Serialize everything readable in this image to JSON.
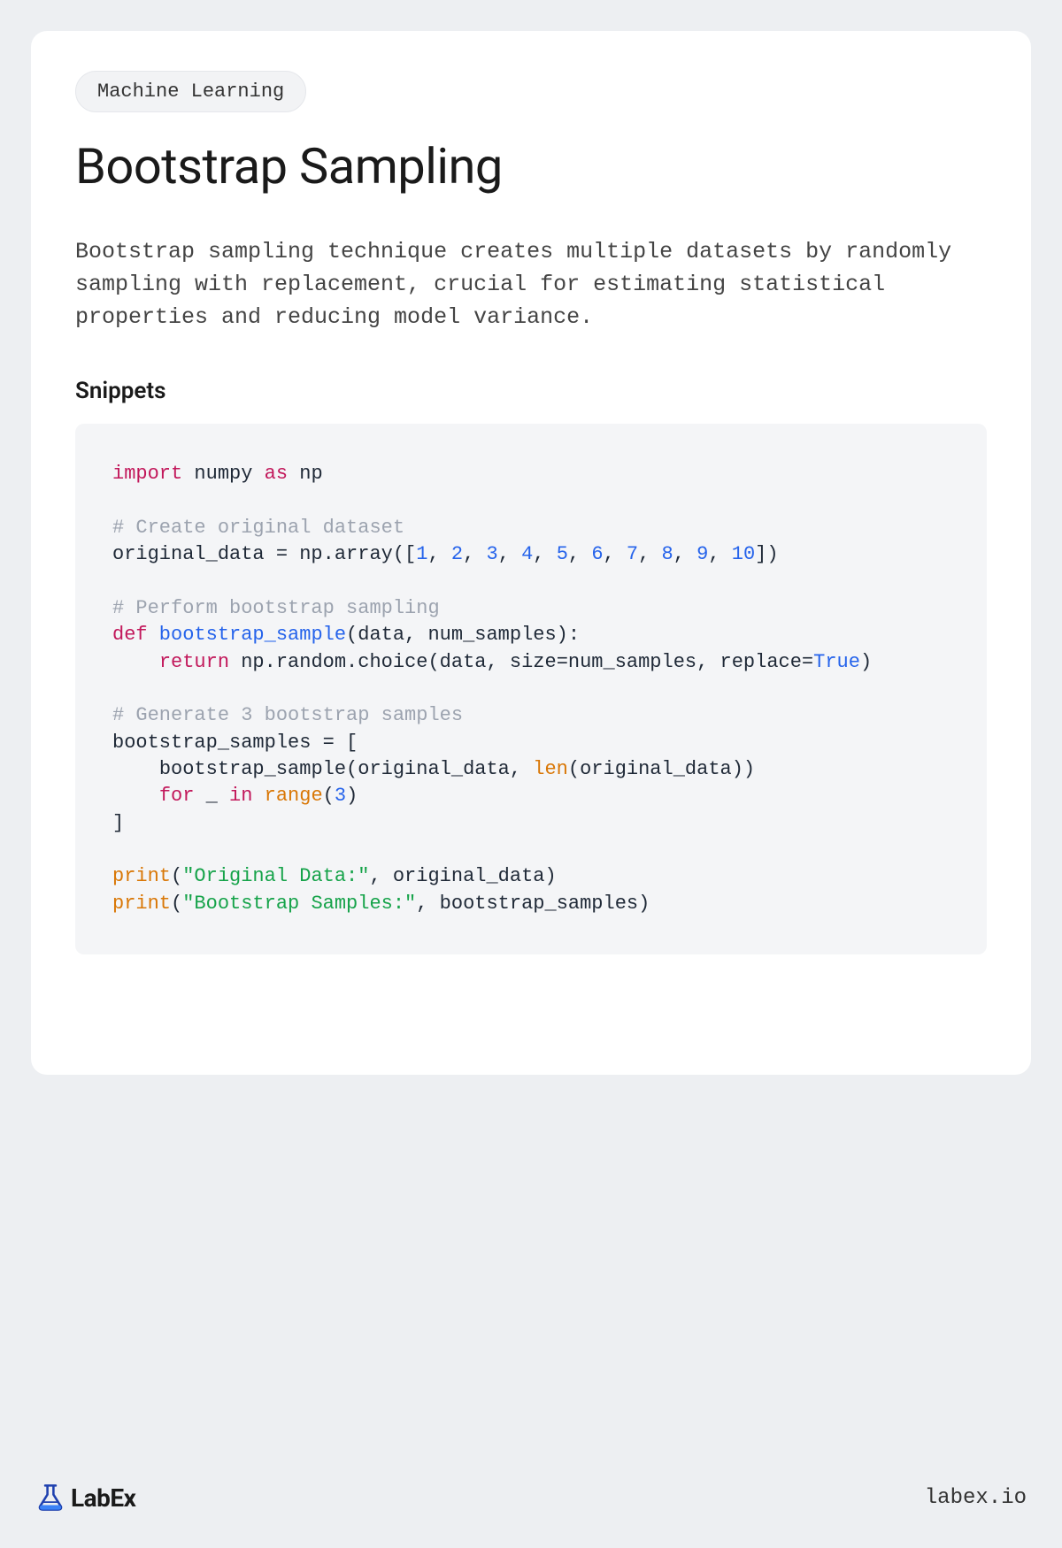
{
  "tag": "Machine Learning",
  "title": "Bootstrap Sampling",
  "description": "Bootstrap sampling technique creates multiple datasets by randomly sampling with replacement, crucial for estimating statistical properties and reducing model variance.",
  "snippets_heading": "Snippets",
  "code": {
    "line1_import": "import",
    "line1_module": " numpy ",
    "line1_as": "as",
    "line1_alias": " np",
    "line3_comment": "# Create original dataset",
    "line4_pre": "original_data = np.array([",
    "line4_nums": [
      "1",
      "2",
      "3",
      "4",
      "5",
      "6",
      "7",
      "8",
      "9",
      "10"
    ],
    "line4_post": "])",
    "line6_comment": "# Perform bootstrap sampling",
    "line7_def": "def",
    "line7_name": " bootstrap_sample",
    "line7_params": "(data, num_samples):",
    "line8_indent": "    ",
    "line8_return": "return",
    "line8_body": " np.random.choice(data, size=num_samples, replace=",
    "line8_true": "True",
    "line8_close": ")",
    "line10_comment": "# Generate 3 bootstrap samples",
    "line11": "bootstrap_samples = [",
    "line12_indent": "    bootstrap_sample(original_data, ",
    "line12_len": "len",
    "line12_post": "(original_data))",
    "line13_indent": "    ",
    "line13_for": "for",
    "line13_mid": " _ ",
    "line13_in": "in",
    "line13_range": " range",
    "line13_open": "(",
    "line13_num": "3",
    "line13_close": ")",
    "line14": "]",
    "line16_print": "print",
    "line16_open": "(",
    "line16_str": "\"Original Data:\"",
    "line16_rest": ", original_data)",
    "line17_print": "print",
    "line17_open": "(",
    "line17_str": "\"Bootstrap Samples:\"",
    "line17_rest": ", bootstrap_samples)"
  },
  "footer": {
    "brand": "LabEx",
    "url": "labex.io"
  }
}
